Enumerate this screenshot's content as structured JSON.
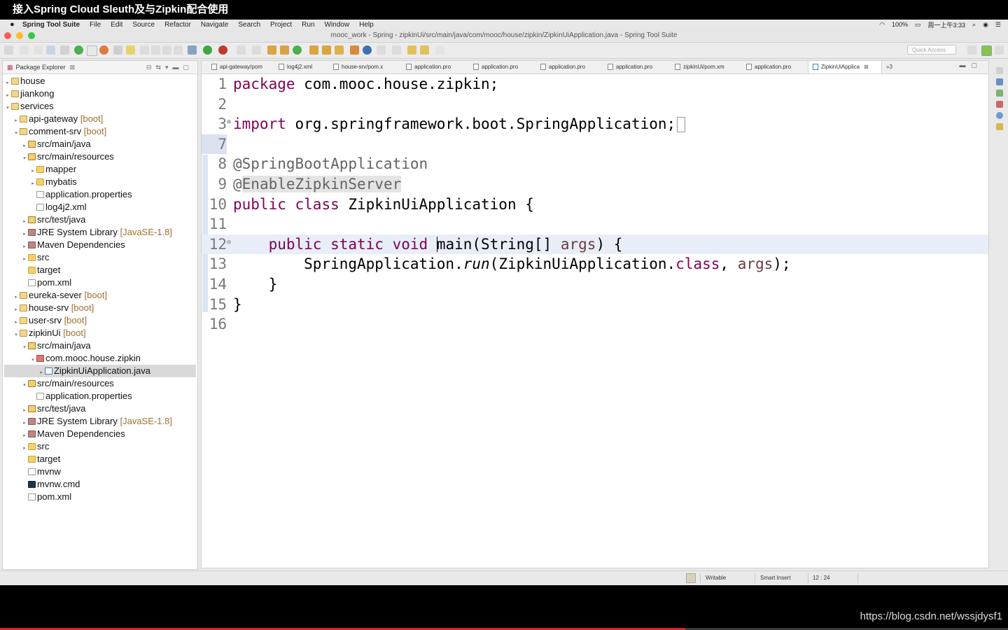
{
  "video": {
    "title": "接入Spring Cloud Sleuth及与Zipkin配合使用",
    "watermark": "https://blog.csdn.net/wssjdysf1",
    "progress": 0.68
  },
  "menubar": {
    "app_name": "Spring Tool Suite",
    "items": [
      "File",
      "Edit",
      "Source",
      "Refactor",
      "Navigate",
      "Search",
      "Project",
      "Run",
      "Window",
      "Help"
    ],
    "battery": "100%",
    "clock": "周一上午3:33"
  },
  "window": {
    "title": "mooc_work - Spring - zipkinUi/src/main/java/com/mooc/house/zipkin/ZipkinUiApplication.java - Spring Tool Suite",
    "colors": {
      "close": "#fc5f57",
      "minimize": "#fdbc2e",
      "zoom": "#33c748"
    }
  },
  "toolbar": {
    "quick_access_placeholder": "Quick Access"
  },
  "package_explorer": {
    "title": "Package Explorer",
    "close_glyph": "⊠",
    "items": [
      {
        "label": "house",
        "suffix": "",
        "icon": "project",
        "depth": 0,
        "expander": "▸"
      },
      {
        "label": "jiankong",
        "suffix": "",
        "icon": "project",
        "depth": 0,
        "expander": "▸"
      },
      {
        "label": "services",
        "suffix": "",
        "icon": "project",
        "depth": 0,
        "expander": "▾"
      },
      {
        "label": "api-gateway",
        "suffix": " [boot]",
        "icon": "project",
        "depth": 1,
        "expander": "▸"
      },
      {
        "label": "comment-srv",
        "suffix": " [boot]",
        "icon": "project",
        "depth": 1,
        "expander": "▾"
      },
      {
        "label": "src/main/java",
        "suffix": "",
        "icon": "srcfolder",
        "depth": 2,
        "expander": "▸"
      },
      {
        "label": "src/main/resources",
        "suffix": "",
        "icon": "srcfolder",
        "depth": 2,
        "expander": "▾"
      },
      {
        "label": "mapper",
        "suffix": "",
        "icon": "folder",
        "depth": 3,
        "expander": "▸"
      },
      {
        "label": "mybatis",
        "suffix": "",
        "icon": "folder",
        "depth": 3,
        "expander": "▸"
      },
      {
        "label": "application.properties",
        "suffix": "",
        "icon": "file",
        "depth": 3,
        "expander": ""
      },
      {
        "label": "log4j2.xml",
        "suffix": "",
        "icon": "file",
        "depth": 3,
        "expander": ""
      },
      {
        "label": "src/test/java",
        "suffix": "",
        "icon": "srcfolder",
        "depth": 2,
        "expander": "▸"
      },
      {
        "label": "JRE System Library",
        "suffix": " [JavaSE-1.8]",
        "icon": "lib",
        "depth": 2,
        "expander": "▸"
      },
      {
        "label": "Maven Dependencies",
        "suffix": "",
        "icon": "lib",
        "depth": 2,
        "expander": "▸"
      },
      {
        "label": "src",
        "suffix": "",
        "icon": "folder",
        "depth": 2,
        "expander": "▸"
      },
      {
        "label": "target",
        "suffix": "",
        "icon": "folder",
        "depth": 2,
        "expander": ""
      },
      {
        "label": "pom.xml",
        "suffix": "",
        "icon": "file",
        "depth": 2,
        "expander": ""
      },
      {
        "label": "eureka-sever",
        "suffix": " [boot]",
        "icon": "project",
        "depth": 1,
        "expander": "▸"
      },
      {
        "label": "house-srv",
        "suffix": " [boot]",
        "icon": "project",
        "depth": 1,
        "expander": "▸"
      },
      {
        "label": "user-srv",
        "suffix": " [boot]",
        "icon": "project",
        "depth": 1,
        "expander": "▸"
      },
      {
        "label": "zipkinUi",
        "suffix": " [boot]",
        "icon": "project",
        "depth": 1,
        "expander": "▾"
      },
      {
        "label": "src/main/java",
        "suffix": "",
        "icon": "srcfolder",
        "depth": 2,
        "expander": "▾"
      },
      {
        "label": "com.mooc.house.zipkin",
        "suffix": "",
        "icon": "pkg",
        "depth": 3,
        "expander": "▾"
      },
      {
        "label": "ZipkinUiApplication.java",
        "suffix": "",
        "icon": "java",
        "depth": 4,
        "expander": "▸",
        "selected": true
      },
      {
        "label": "src/main/resources",
        "suffix": "",
        "icon": "srcfolder",
        "depth": 2,
        "expander": "▾"
      },
      {
        "label": "application.properties",
        "suffix": "",
        "icon": "file",
        "depth": 3,
        "expander": ""
      },
      {
        "label": "src/test/java",
        "suffix": "",
        "icon": "srcfolder",
        "depth": 2,
        "expander": "▸"
      },
      {
        "label": "JRE System Library",
        "suffix": " [JavaSE-1.8]",
        "icon": "lib",
        "depth": 2,
        "expander": "▸"
      },
      {
        "label": "Maven Dependencies",
        "suffix": "",
        "icon": "lib",
        "depth": 2,
        "expander": "▸"
      },
      {
        "label": "src",
        "suffix": "",
        "icon": "folder",
        "depth": 2,
        "expander": "▸"
      },
      {
        "label": "target",
        "suffix": "",
        "icon": "folder",
        "depth": 2,
        "expander": ""
      },
      {
        "label": "mvnw",
        "suffix": "",
        "icon": "file",
        "depth": 2,
        "expander": ""
      },
      {
        "label": "mvnw.cmd",
        "suffix": "",
        "icon": "cmd",
        "depth": 2,
        "expander": ""
      },
      {
        "label": "pom.xml",
        "suffix": "",
        "icon": "file",
        "depth": 2,
        "expander": ""
      }
    ]
  },
  "editor": {
    "tabs": [
      {
        "label": "api-gateway/pom"
      },
      {
        "label": "log4j2.xml"
      },
      {
        "label": "house-srv/pom.x"
      },
      {
        "label": "application.pro"
      },
      {
        "label": "application.pro"
      },
      {
        "label": "application.pro"
      },
      {
        "label": "application.pro"
      },
      {
        "label": "zipkinUi/pom.xm"
      },
      {
        "label": "application.pro"
      },
      {
        "label": "ZipkinUiApplica",
        "active": true
      }
    ],
    "tab_close_glyph": "⊠",
    "tab_overflow": "»3",
    "lines": [
      {
        "num": "1",
        "segments": [
          {
            "t": "package",
            "c": "kw"
          },
          {
            "t": " com.mooc.house.zipkin;",
            "c": ""
          }
        ]
      },
      {
        "num": "2",
        "segments": []
      },
      {
        "num": "3",
        "fold": "+",
        "segments": [
          {
            "t": "import",
            "c": "kw"
          },
          {
            "t": " org.springframework.boot.SpringApplication;",
            "c": ""
          }
        ],
        "box": true
      },
      {
        "num": "7",
        "segments": [],
        "sel7": true
      },
      {
        "num": "8",
        "segments": [
          {
            "t": "@SpringBootApplication",
            "c": "ann"
          }
        ]
      },
      {
        "num": "9",
        "segments": [
          {
            "t": "@",
            "c": "ann"
          },
          {
            "t": "EnableZipkinServer",
            "c": "ann hl"
          }
        ]
      },
      {
        "num": "10",
        "segments": [
          {
            "t": "public",
            "c": "kw"
          },
          {
            "t": " ",
            "c": ""
          },
          {
            "t": "class",
            "c": "kw"
          },
          {
            "t": " ZipkinUiApplication {",
            "c": ""
          }
        ]
      },
      {
        "num": "11",
        "segments": []
      },
      {
        "num": "12",
        "fold": "-",
        "current": true,
        "segments": [
          {
            "t": "    ",
            "c": ""
          },
          {
            "t": "public",
            "c": "kw"
          },
          {
            "t": " ",
            "c": ""
          },
          {
            "t": "static",
            "c": "kw"
          },
          {
            "t": " ",
            "c": ""
          },
          {
            "t": "void",
            "c": "kw"
          },
          {
            "t": " ",
            "c": ""
          },
          {
            "caret": true
          },
          {
            "t": "main(String[] ",
            "c": ""
          },
          {
            "t": "args",
            "c": "param"
          },
          {
            "t": ") {",
            "c": ""
          }
        ]
      },
      {
        "num": "13",
        "segments": [
          {
            "t": "        SpringApplication.",
            "c": ""
          },
          {
            "t": "run",
            "c": "ital"
          },
          {
            "t": "(ZipkinUiApplication.",
            "c": ""
          },
          {
            "t": "class",
            "c": "kw"
          },
          {
            "t": ", ",
            "c": ""
          },
          {
            "t": "args",
            "c": "param"
          },
          {
            "t": ");",
            "c": ""
          }
        ]
      },
      {
        "num": "14",
        "segments": [
          {
            "t": "    }",
            "c": ""
          }
        ]
      },
      {
        "num": "15",
        "segments": [
          {
            "t": "}",
            "c": ""
          }
        ]
      },
      {
        "num": "16",
        "segments": []
      }
    ]
  },
  "statusbar": {
    "writable": "Writable",
    "insert_mode": "Smart Insert",
    "position": "12 : 24"
  }
}
